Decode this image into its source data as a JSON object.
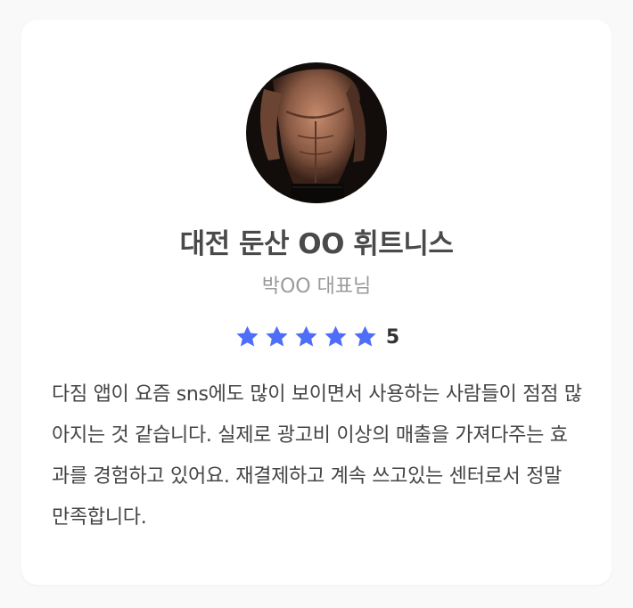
{
  "card": {
    "gym_name": "대전 둔산 OO 휘트니스",
    "owner_name": "박OO 대표님",
    "rating": {
      "stars": 5,
      "max_stars": 5,
      "value_label": "5",
      "star_color": "#4f6ef7"
    },
    "review_text": "다짐 앱이 요즘 sns에도 많이 보이면서 사용하는 사람들이 점점 많아지는 것 같습니다. 실제로 광고비 이상의 매출을 가져다주는 효과를 경험하고 있어요. 재결제하고 계속 쓰고있는 센터로서 정말 만족합니다.",
    "avatar": {
      "icon": "profile-photo-fitness-man"
    }
  }
}
